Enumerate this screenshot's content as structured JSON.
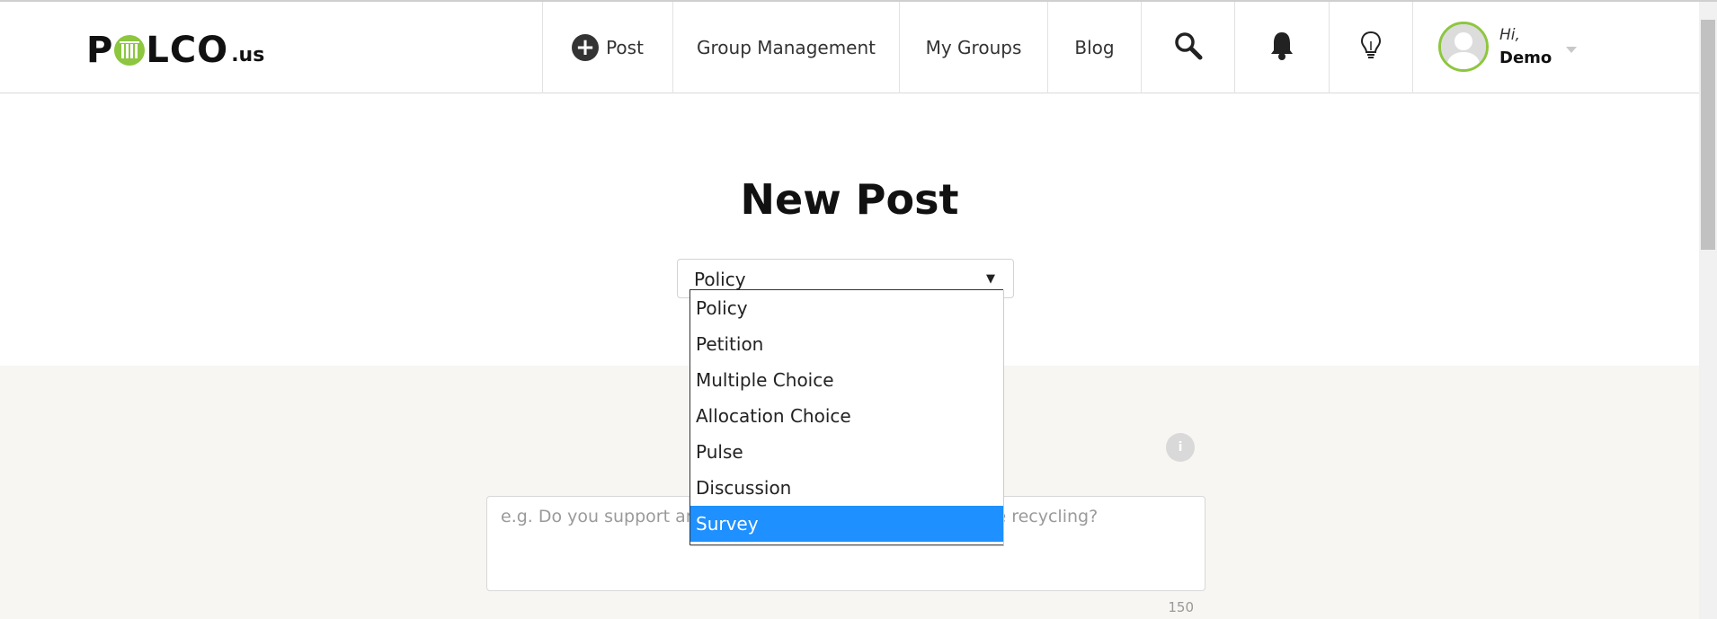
{
  "logo": {
    "main_left": "P",
    "main_right": "LCO",
    "suffix": ".us"
  },
  "nav": {
    "post_label": "Post",
    "group_management_label": "Group Management",
    "my_groups_label": "My Groups",
    "blog_label": "Blog"
  },
  "user": {
    "greeting": "Hi,",
    "name": "Demo"
  },
  "page": {
    "title": "New Post"
  },
  "post_type": {
    "selected": "Policy",
    "arrow": "▼",
    "options": [
      "Policy",
      "Petition",
      "Multiple Choice",
      "Allocation Choice",
      "Pulse",
      "Discussion",
      "Survey"
    ],
    "highlighted": "Survey"
  },
  "question": {
    "placeholder": "e.g. Do you support an increase in fees to expand curbside recycling?",
    "char_count": "150",
    "info_glyph": "i"
  },
  "colors": {
    "brand_green": "#8dc63f",
    "highlight_blue": "#1e90ff"
  },
  "icons": [
    "plus-circle-icon",
    "search-icon",
    "bell-icon",
    "lightbulb-icon",
    "avatar-icon",
    "chevron-down-icon",
    "info-icon"
  ]
}
